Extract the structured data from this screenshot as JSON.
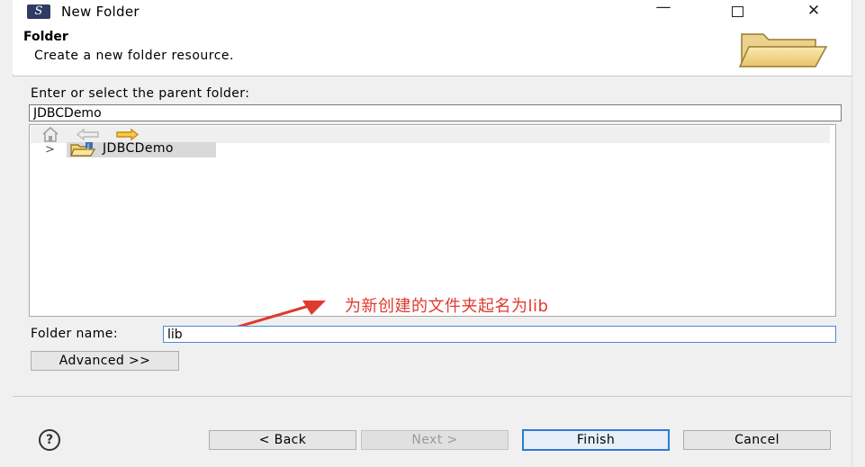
{
  "window": {
    "title": "New Folder",
    "icon": "eclipse-app-icon",
    "min": "—",
    "close": "✕"
  },
  "header": {
    "title": "Folder",
    "description": "Create a new folder resource.",
    "icon": "folder-banner-icon"
  },
  "parent": {
    "label": "Enter or select the parent folder:",
    "value": "JDBCDemo",
    "toolbar": [
      "home-icon",
      "back-arrow-icon",
      "forward-arrow-icon"
    ],
    "tree_items": [
      {
        "label": "JDBCDemo",
        "expander": ">"
      }
    ]
  },
  "folder_name": {
    "label": "Folder name:",
    "value": "lib"
  },
  "advanced": {
    "label": "Advanced >>"
  },
  "annotation": {
    "text": "为新创建的文件夹起名为lib",
    "color": "#e03a2f"
  },
  "footer": {
    "help": "?",
    "back": "< Back",
    "next": "Next >",
    "finish": "Finish",
    "cancel": "Cancel"
  }
}
